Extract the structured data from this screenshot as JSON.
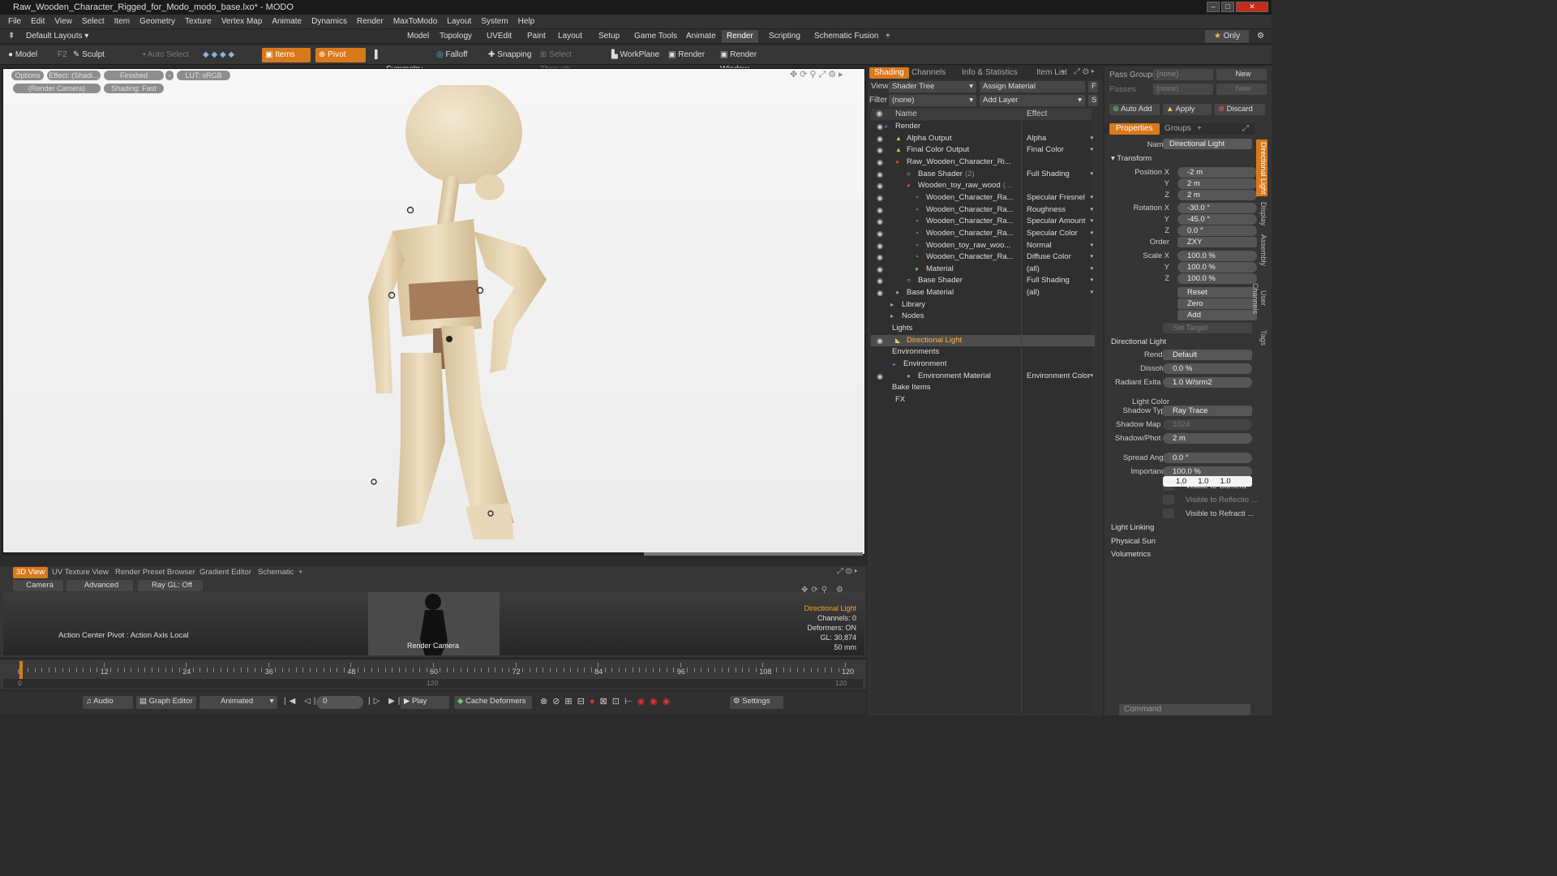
{
  "window": {
    "title": "Raw_Wooden_Character_Rigged_for_Modo_modo_base.lxo* - MODO"
  },
  "menu": [
    "File",
    "Edit",
    "View",
    "Select",
    "Item",
    "Geometry",
    "Texture",
    "Vertex Map",
    "Animate",
    "Dynamics",
    "Render",
    "MaxToModo",
    "Layout",
    "System",
    "Help"
  ],
  "layouts": {
    "label": "Default Layouts",
    "tabs": [
      "Model",
      "Topology",
      "UVEdit",
      "Paint",
      "Layout",
      "Setup",
      "Game Tools",
      "Animate",
      "Render",
      "Scripting",
      "Schematic Fusion"
    ],
    "active": "Render",
    "only": "Only",
    "plus": "+"
  },
  "toolbar": {
    "model": "Model",
    "f2": "F2",
    "sculpt": "Sculpt",
    "auto_select": "Auto Select",
    "items": "Items",
    "pivot": "Pivot",
    "symmetry": "Symmetry",
    "falloff": "Falloff",
    "snapping": "Snapping",
    "select_through": "Select Through",
    "workplane": "WorkPlane",
    "render": "Render",
    "render_window": "Render Window"
  },
  "viewport": {
    "pills": [
      "Options",
      "Effect: (Shadi...",
      "Finished",
      "LUT: sRGB",
      "(Render Camera)",
      "Shading: Fast"
    ]
  },
  "bottom": {
    "tabs": [
      "3D View",
      "UV Texture View",
      "Render Preset Browser",
      "Gradient Editor",
      "Schematic",
      "+"
    ],
    "sub": [
      "Camera",
      "Advanced",
      "Ray GL: Off"
    ],
    "action_center": "Action Center Pivot : Action Axis Local",
    "cam_label": "Render Camera",
    "info": [
      "Directional Light",
      "Channels: 0",
      "Deformers: ON",
      "GL: 30,874",
      "50 mm"
    ]
  },
  "timeline": {
    "ticks": [
      "0",
      "12",
      "24",
      "36",
      "48",
      "60",
      "72",
      "84",
      "96",
      "108",
      "120"
    ],
    "sub_left": "0",
    "sub_mid": "120",
    "sub_right": "120"
  },
  "transport": {
    "audio": "Audio",
    "graph": "Graph Editor",
    "animated": "Animated",
    "frame": "0",
    "play": "Play",
    "cache": "Cache Deformers",
    "settings": "Settings"
  },
  "shading": {
    "tabs": [
      "Shading",
      "Channels",
      "Info & Statistics",
      "Item List",
      "+"
    ],
    "view_label": "View",
    "view_value": "Shader Tree",
    "assign": "Assign Material",
    "f_btn": "F",
    "filter_label": "Filter",
    "filter_value": "(none)",
    "add_layer": "Add Layer",
    "s_btn": "S",
    "col_name": "Name",
    "col_effect": "Effect",
    "rows": [
      {
        "name": "Render",
        "effect": "",
        "eye": "◉"
      },
      {
        "name": "Alpha Output",
        "effect": "Alpha",
        "eye": "◉"
      },
      {
        "name": "Final Color Output",
        "effect": "Final Color",
        "eye": "◉"
      },
      {
        "name": "Raw_Wooden_Character_Ri...",
        "effect": "",
        "eye": "◉"
      },
      {
        "name": "Base Shader",
        "extra": "(2)",
        "effect": "Full Shading",
        "eye": "◉"
      },
      {
        "name": "Wooden_toy_raw_wood",
        "extra": "(...",
        "effect": "",
        "eye": "◉"
      },
      {
        "name": "Wooden_Character_Ra...",
        "effect": "Specular Fresnel",
        "eye": "◉"
      },
      {
        "name": "Wooden_Character_Ra...",
        "effect": "Roughness",
        "eye": "◉"
      },
      {
        "name": "Wooden_Character_Ra...",
        "effect": "Specular Amount",
        "eye": "◉"
      },
      {
        "name": "Wooden_Character_Ra...",
        "effect": "Specular Color",
        "eye": "◉"
      },
      {
        "name": "Wooden_toy_raw_woo...",
        "effect": "Normal",
        "eye": "◉"
      },
      {
        "name": "Wooden_Character_Ra...",
        "effect": "Diffuse Color",
        "eye": "◉"
      },
      {
        "name": "Material",
        "effect": "(all)",
        "eye": "◉"
      },
      {
        "name": "Base Shader",
        "effect": "Full Shading",
        "eye": "◉"
      },
      {
        "name": "Base Material",
        "effect": "(all)",
        "eye": "◉"
      },
      {
        "name": "Library",
        "effect": "",
        "eye": ""
      },
      {
        "name": "Nodes",
        "effect": "",
        "eye": ""
      },
      {
        "name": "Lights",
        "effect": "",
        "eye": ""
      },
      {
        "name": "Directional Light",
        "effect": "",
        "eye": "◉"
      },
      {
        "name": "Environments",
        "effect": "",
        "eye": ""
      },
      {
        "name": "Environment",
        "effect": "",
        "eye": ""
      },
      {
        "name": "Environment Material",
        "effect": "Environment Color",
        "eye": "◉"
      },
      {
        "name": "Bake Items",
        "effect": "",
        "eye": ""
      },
      {
        "name": "FX",
        "effect": "",
        "eye": ""
      }
    ]
  },
  "props": {
    "pass_groups": "Pass Groups",
    "passes": "Passes",
    "none": "(none)",
    "new": "New",
    "auto_add": "Auto Add",
    "apply": "Apply",
    "discard": "Discard",
    "tabs": [
      "Properties",
      "Groups",
      "+"
    ],
    "name_label": "Name",
    "name_value": "Directional Light",
    "transform": "Transform",
    "pos": [
      "-2 m",
      "2 m",
      "2 m"
    ],
    "rot": [
      "-30.0 °",
      "-45.0 °",
      "0.0 °"
    ],
    "order": "ZXY",
    "scale": [
      "100.0 %",
      "100.0 %",
      "100.0 %"
    ],
    "reset": "Reset",
    "zero": "Zero",
    "add": "Add",
    "set_target": "Set Target",
    "dl_section": "Directional Light",
    "render_label": "Render",
    "render_value": "Default",
    "dissolve": "0.0 %",
    "radiant_label": "Radiant Exita ...",
    "radiant": "1.0 W/srm2",
    "light_color_label": "Light Color",
    "light_color": [
      "1.0",
      "1.0",
      "1.0"
    ],
    "shadow_type_label": "Shadow Type",
    "shadow_type": "Ray Trace",
    "shadow_map_label": "Shadow Map ...",
    "shadow_map": "1024",
    "shadow_phot_label": "Shadow/Phot ...",
    "shadow_phot": "2 m",
    "spread_label": "Spread Angle",
    "spread": "0.0 °",
    "importance_label": "Importance",
    "importance": "100.0 %",
    "vis_cam": "Visible to Camera",
    "vis_refl": "Visible to Reflectio ...",
    "vis_refr": "Visible to Refracti ...",
    "light_linking": "Light Linking",
    "physical_sun": "Physical Sun",
    "volumetrics": "Volumetrics",
    "side_tabs": [
      "Directional Light",
      "Display",
      "Assembly",
      "User Channels",
      "Tags"
    ],
    "labels": {
      "posx": "Position X",
      "y": "Y",
      "z": "Z",
      "rotx": "Rotation X",
      "order": "Order",
      "scalex": "Scale X",
      "dissolve": "Dissolve"
    },
    "command": "Command"
  }
}
